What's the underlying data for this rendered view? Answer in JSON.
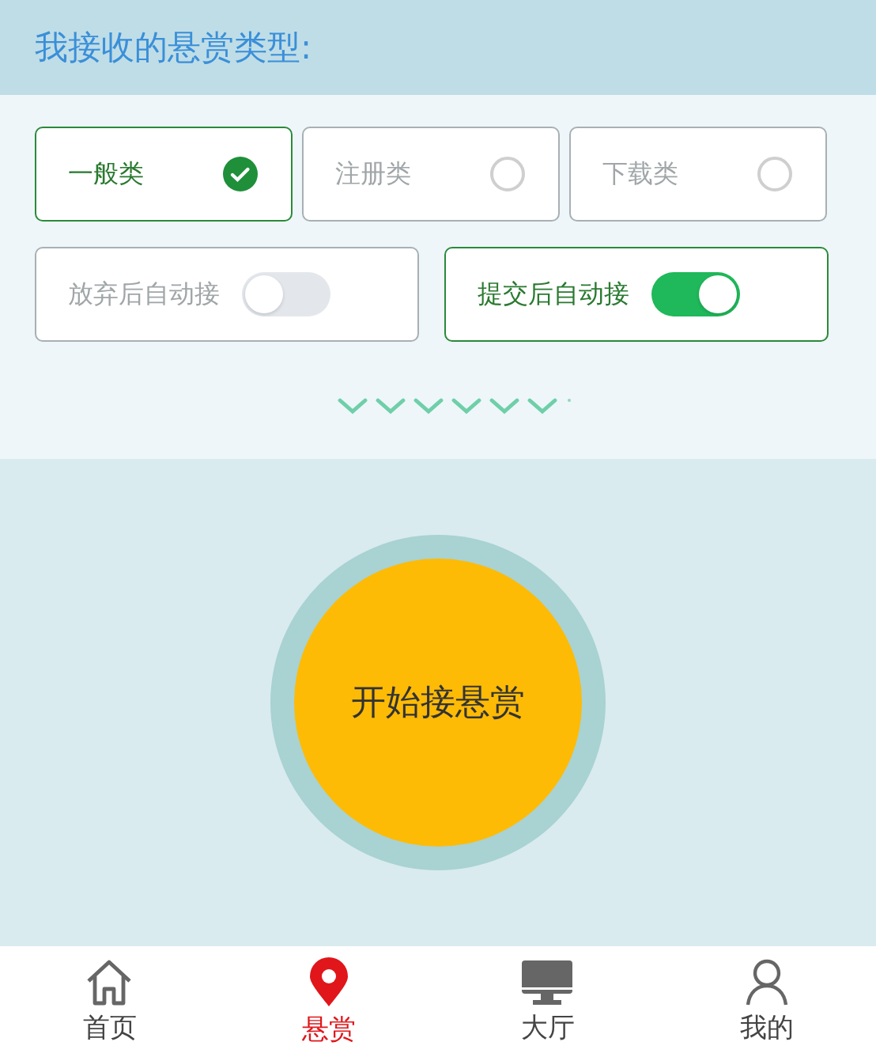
{
  "header": {
    "title": "我接收的悬赏类型:"
  },
  "categories": [
    {
      "label": "一般类",
      "selected": true
    },
    {
      "label": "注册类",
      "selected": false
    },
    {
      "label": "下载类",
      "selected": false
    }
  ],
  "auto_options": [
    {
      "label": "放弃后自动接",
      "on": false
    },
    {
      "label": "提交后自动接",
      "on": true
    }
  ],
  "start_button": {
    "label": "开始接悬赏"
  },
  "nav": [
    {
      "label": "首页",
      "kind": "home",
      "selected": false
    },
    {
      "label": "悬赏",
      "kind": "pin",
      "selected": true
    },
    {
      "label": "大厅",
      "kind": "monitor",
      "selected": false
    },
    {
      "label": "我的",
      "kind": "user",
      "selected": false
    }
  ]
}
